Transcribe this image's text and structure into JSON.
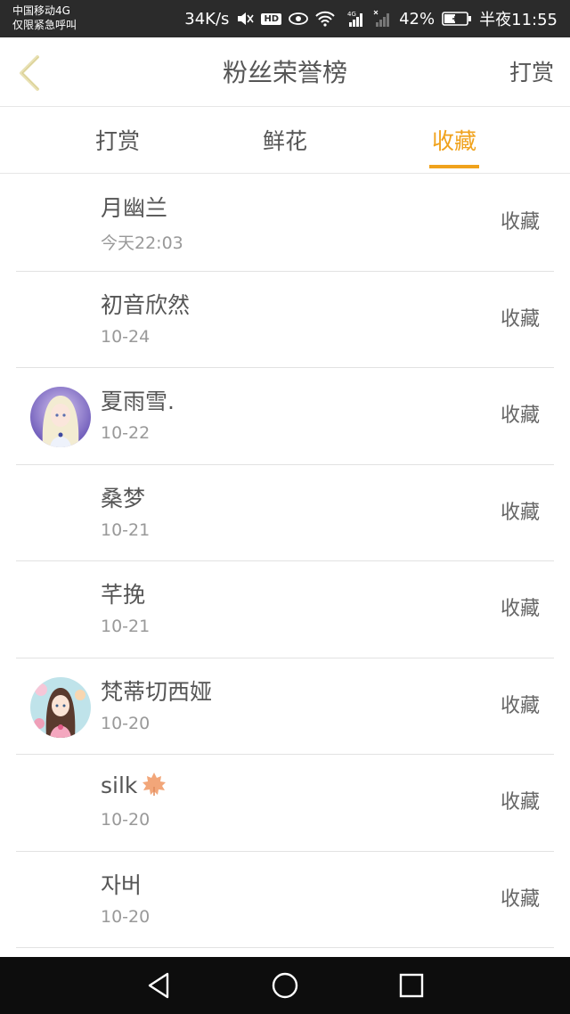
{
  "status_bar": {
    "carrier": "中国移动4G",
    "carrier_note": "仅限紧急呼叫",
    "speed": "34K/s",
    "hd": "HD",
    "network": "4G",
    "battery": "42%",
    "time": "半夜11:55"
  },
  "header": {
    "title": "粉丝荣誉榜",
    "action": "打赏"
  },
  "tabs": [
    {
      "label": "打赏",
      "active": false
    },
    {
      "label": "鲜花",
      "active": false
    },
    {
      "label": "收藏",
      "active": true
    }
  ],
  "colors": {
    "accent": "#f0a21c",
    "text": "#555555",
    "subtext": "#999999"
  },
  "list": [
    {
      "name": "月幽兰",
      "date": "今天22:03",
      "action": "收藏",
      "avatar": "none"
    },
    {
      "name": "初音欣然",
      "date": "10-24",
      "action": "收藏",
      "avatar": "none"
    },
    {
      "name": "夏雨雪.",
      "date": "10-22",
      "action": "收藏",
      "avatar": "anime-girl-white-hair"
    },
    {
      "name": "桑梦",
      "date": "10-21",
      "action": "收藏",
      "avatar": "none"
    },
    {
      "name": "芊挽",
      "date": "10-21",
      "action": "收藏",
      "avatar": "none"
    },
    {
      "name": "梵蒂切西娅",
      "date": "10-20",
      "action": "收藏",
      "avatar": "anime-girl-brown-hair"
    },
    {
      "name": "silk",
      "date": "10-20",
      "action": "收藏",
      "avatar": "none",
      "emoji": "maple-leaf-icon"
    },
    {
      "name": "자버",
      "date": "10-20",
      "action": "收藏",
      "avatar": "none"
    }
  ]
}
